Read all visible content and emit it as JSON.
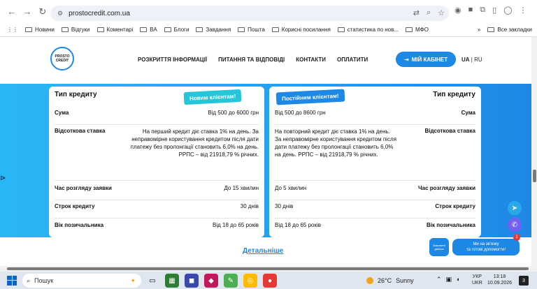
{
  "browser": {
    "url": "prostocredit.com.ua",
    "bookmarks": [
      "Новини",
      "Відгуки",
      "Коментарі",
      "ВА",
      "Блоги",
      "Завдання",
      "Пошта",
      "Корисні посилання",
      "статистика по нов...",
      "МФО"
    ],
    "all_bookmarks": "Все закладки",
    "more_bookmarks": "»"
  },
  "site": {
    "logo_line1": "PROSTO",
    "logo_line2": "CREDIT",
    "menu": [
      "РОЗКРИТТЯ ІНФОРМАЦІЇ",
      "ПИТАННЯ ТА ВІДПОВІДІ",
      "КОНТАКТИ",
      "ОПЛАТИТИ"
    ],
    "cabinet": "МІЙ КАБІНЕТ",
    "lang_ua": "UA",
    "lang_sep": "|",
    "lang_ru": "RU"
  },
  "new_clients": {
    "badge": "Новим клієнтам!",
    "title": "Тип кредиту",
    "rows": [
      {
        "k": "Сума",
        "v": "Від 500 до 6000 грн"
      },
      {
        "k": "Відсоткова ставка",
        "v": "На перший кредит діє ставка 1% на день. За неправомірне користування кредитом після дати платежу без пролонгації становить 6,0% на день. РРПС – від 21918,79 % річних."
      },
      {
        "k": "Час розгляду заявки",
        "v": "До 15 хвилин"
      },
      {
        "k": "Строк кредиту",
        "v": "30 днів"
      },
      {
        "k": "Вік позичальника",
        "v": "Від 18 до 65 років"
      }
    ]
  },
  "regular_clients": {
    "badge": "Постійним клієнтам!",
    "title": "Тип кредиту",
    "rows": [
      {
        "k": "Сума",
        "v": "Від 500 до 8600 грн"
      },
      {
        "k": "Відсоткова ставка",
        "v": "На повторний кредит діє ставка 1% на день. За неправомірне користування кредитом після дати платежу без пролонгації становить 6,0% на день. РРПС – від 21918,79 % річних."
      },
      {
        "k": "Час розгляду заявки",
        "v": "До 5 хвилин"
      },
      {
        "k": "Строк кредиту",
        "v": "30 днів"
      },
      {
        "k": "Вік позичальника",
        "v": "Від 18 до 65 років"
      }
    ]
  },
  "more_link": "Детальніше",
  "chat": {
    "line1": "Ми на зв'язку",
    "line2": "та готові допомогти!",
    "count": "1",
    "call": "Замовити дзвінок"
  },
  "taskbar": {
    "search": "Пошук",
    "temp": "26°C",
    "weather": "Sunny",
    "lang1": "УКР",
    "lang2": "UKR",
    "time": "13:18",
    "date": "10.09.2026",
    "notifications": "3"
  }
}
